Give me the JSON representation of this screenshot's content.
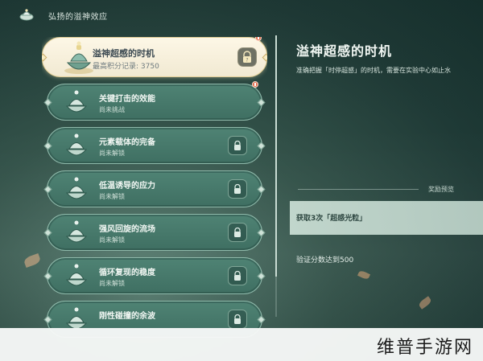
{
  "header": {
    "title": "弘扬的溢神效应",
    "icon": "bowl-icon"
  },
  "challenges": [
    {
      "title": "溢神超感的时机",
      "subtitle": "最高积分记录: 3750",
      "state": "selected",
      "badge": true,
      "icon": "question-lock-icon"
    },
    {
      "title": "关键打击的效能",
      "subtitle": "尚未挑战",
      "state": "available",
      "badge": true,
      "icon": ""
    },
    {
      "title": "元素载体的完备",
      "subtitle": "尚未解锁",
      "state": "locked",
      "badge": false,
      "icon": "lock-icon"
    },
    {
      "title": "低温诱导的应力",
      "subtitle": "尚未解锁",
      "state": "locked",
      "badge": false,
      "icon": "lock-icon"
    },
    {
      "title": "强风回旋的流场",
      "subtitle": "尚未解锁",
      "state": "locked",
      "badge": false,
      "icon": "lock-icon"
    },
    {
      "title": "循环复现的稳度",
      "subtitle": "尚未解锁",
      "state": "locked",
      "badge": false,
      "icon": "lock-icon"
    },
    {
      "title": "刚性碰撞的余波",
      "subtitle": "",
      "state": "locked",
      "badge": false,
      "icon": "lock-icon"
    }
  ],
  "detail": {
    "title": "溢神超感的时机",
    "description": "准确把握「时停超感」的时机，需要在实验中心如止水",
    "reward_section_label": "奖励预览",
    "reward_text": "获取3次「超感光粒」",
    "verify_text": "验证分数达到500"
  },
  "watermark": "维普手游网",
  "colors": {
    "card": "#4a7d6f",
    "selected_card": "#f8f1dc",
    "badge": "#e26e4f",
    "background": "#2a4a44"
  }
}
